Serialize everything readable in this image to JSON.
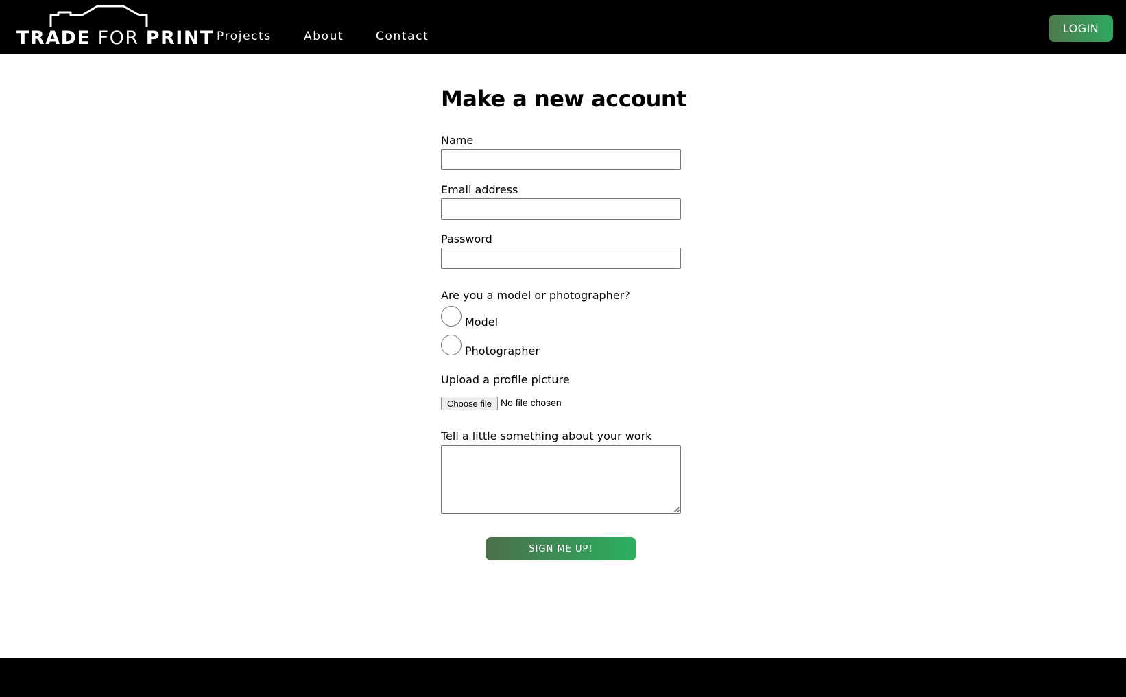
{
  "nav": {
    "logo": {
      "bold_1": "TRADE",
      "light": "FOR",
      "bold_2": "PRINT",
      "icon": "camera-outline-icon"
    },
    "links": [
      "Projects",
      "About",
      "Contact"
    ],
    "login_label": "LOGIN"
  },
  "form": {
    "title": "Make a new account",
    "name_label": "Name",
    "email_label": "Email address",
    "password_label": "Password",
    "name_value": "",
    "email_value": "",
    "password_value": "",
    "role_question": "Are you a model or photographer?",
    "role_options": [
      "Model",
      "Photographer"
    ],
    "upload_label": "Upload a profile picture",
    "file_button_label": "Choose file",
    "file_status": "No file chosen",
    "about_label": "Tell a little something about your work",
    "about_value": "",
    "submit_label": "SIGN ME UP!"
  },
  "colors": {
    "navbar_bg": "#000000",
    "button_gradient_start": "#4c6e4c",
    "button_gradient_end": "#2bb060"
  }
}
